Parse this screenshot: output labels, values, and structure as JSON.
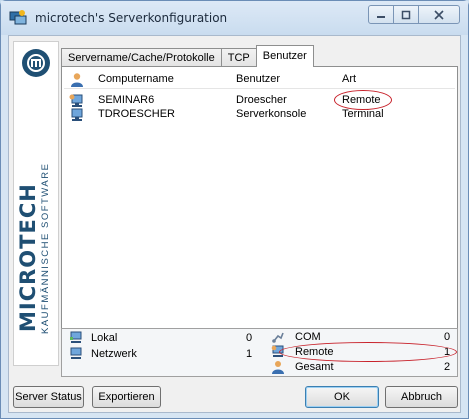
{
  "window": {
    "title": "microtech's Serverkonfiguration",
    "controls": [
      "minimize",
      "maximize",
      "close"
    ]
  },
  "logo": {
    "wordmark": "MICROTECH",
    "subtitle": "KAUFMÄNNISCHE SOFTWARE"
  },
  "tabs": [
    {
      "label": "Servername/Cache/Protokolle",
      "active": false
    },
    {
      "label": "TCP",
      "active": false
    },
    {
      "label": "Benutzer",
      "active": true
    }
  ],
  "table": {
    "columns": [
      "Computername",
      "Benutzer",
      "Art"
    ],
    "rows": [
      {
        "computer": "SEMINAR6",
        "user": "Droescher",
        "type": "Remote",
        "icon": "remote-computer-icon"
      },
      {
        "computer": "TDROESCHER",
        "user": "Serverkonsole",
        "type": "Terminal",
        "icon": "computer-icon"
      }
    ]
  },
  "stats": {
    "lokal_label": "Lokal",
    "lokal_value": "0",
    "netzwerk_label": "Netzwerk",
    "netzwerk_value": "1",
    "com_label": "COM",
    "com_value": "0",
    "remote_label": "Remote",
    "remote_value": "1",
    "gesamt_label": "Gesamt",
    "gesamt_value": "2"
  },
  "buttons": {
    "server_status": "Server Status",
    "exportieren": "Exportieren",
    "ok": "OK",
    "abbruch": "Abbruch"
  },
  "colors": {
    "brand": "#1f4f73",
    "annotation": "#c8232c",
    "title_bar": "#c9dcef"
  }
}
